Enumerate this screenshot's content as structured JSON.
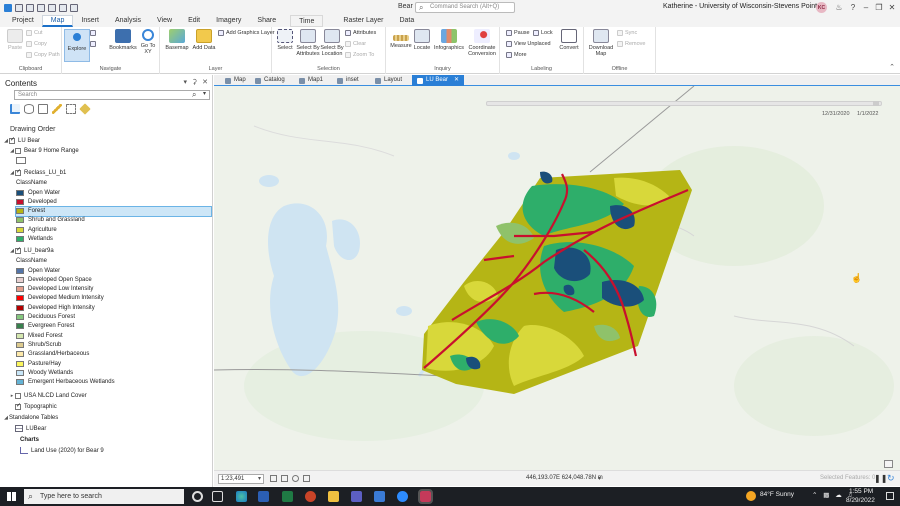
{
  "window": {
    "document_title": "Bear",
    "command_search_placeholder": "Command Search (Alt+Q)",
    "user": "Katherine - University of Wisconsin-Stevens Point",
    "user_initials": "KC"
  },
  "ribbon_tabs": [
    {
      "label": "Project",
      "active": false
    },
    {
      "label": "Map",
      "active": true
    },
    {
      "label": "Insert",
      "active": false
    },
    {
      "label": "Analysis",
      "active": false
    },
    {
      "label": "View",
      "active": false
    },
    {
      "label": "Edit",
      "active": false
    },
    {
      "label": "Imagery",
      "active": false
    },
    {
      "label": "Share",
      "active": false
    },
    {
      "label": "Time",
      "active": false
    },
    {
      "label": "Raster Layer",
      "active": false
    },
    {
      "label": "Data",
      "active": false
    }
  ],
  "ribbon": {
    "clipboard": {
      "label": "Clipboard",
      "paste": "Paste",
      "cut": "Cut",
      "copy": "Copy",
      "copy_path": "Copy Path"
    },
    "navigate": {
      "label": "Navigate",
      "explore": "Explore",
      "bookmarks": "Bookmarks",
      "goto": "Go To XY"
    },
    "layer": {
      "label": "Layer",
      "basemap": "Basemap",
      "add_data": "Add Data",
      "add_graphics": "Add Graphics Layer"
    },
    "selection": {
      "label": "Selection",
      "select": "Select",
      "by_attributes": "Select By Attributes",
      "by_location": "Select By Location",
      "attributes": "Attributes",
      "clear": "Clear",
      "zoom_to": "Zoom To"
    },
    "inquiry": {
      "label": "Inquiry",
      "measure": "Measure",
      "locate": "Locate",
      "infographics": "Infographics",
      "coordinate": "Coordinate Conversion"
    },
    "labeling": {
      "label": "Labeling",
      "pause": "Pause",
      "lock": "Lock",
      "view_unplaced": "View Unplaced",
      "more": "More",
      "convert": "Convert"
    },
    "offline": {
      "label": "Offline",
      "download": "Download Map",
      "sync": "Sync",
      "remove": "Remove"
    }
  },
  "contents": {
    "title": "Contents",
    "search_placeholder": "Search",
    "drawing_order": "Drawing Order",
    "map_name": "LU Bear",
    "layers": [
      {
        "name": "Bear 9 Home Range",
        "checked": false
      },
      {
        "name": "Reclass_LU_b1",
        "checked": true,
        "field": "ClassName",
        "classes": [
          {
            "label": "Open Water",
            "color": "#1a4f7a"
          },
          {
            "label": "Developed",
            "color": "#c8102e"
          },
          {
            "label": "Forest",
            "color": "#b5b515",
            "selected": true
          },
          {
            "label": "Shrub and Grassland",
            "color": "#8fc26a"
          },
          {
            "label": "Agriculture",
            "color": "#d8d83a"
          },
          {
            "label": "Wetlands",
            "color": "#2eae6a"
          }
        ]
      },
      {
        "name": "LU_bear9a",
        "checked": true,
        "field": "ClassName",
        "classes": [
          {
            "label": "Open Water",
            "color": "#5475a8"
          },
          {
            "label": "Developed Open Space",
            "color": "#e8d1d1"
          },
          {
            "label": "Developed Low Intensity",
            "color": "#e29e8c"
          },
          {
            "label": "Developed Medium Intensity",
            "color": "#ff0000"
          },
          {
            "label": "Developed High Intensity",
            "color": "#b50000"
          },
          {
            "label": "Deciduous Forest",
            "color": "#85c77e"
          },
          {
            "label": "Evergreen Forest",
            "color": "#38814e"
          },
          {
            "label": "Mixed Forest",
            "color": "#d4e7b0"
          },
          {
            "label": "Shrub/Scrub",
            "color": "#dcca8f"
          },
          {
            "label": "Grassland/Herbaceous",
            "color": "#fde9aa"
          },
          {
            "label": "Pasture/Hay",
            "color": "#fbf65d"
          },
          {
            "label": "Woody Wetlands",
            "color": "#c8e6f8"
          },
          {
            "label": "Emergent Herbaceous Wetlands",
            "color": "#64b3d5"
          }
        ]
      },
      {
        "name": "USA NLCD Land Cover",
        "checked": false
      },
      {
        "name": "Topographic",
        "checked": true
      }
    ],
    "standalone_tables": "Standalone Tables",
    "table_name": "LUBear",
    "charts_label": "Charts",
    "chart_name": "Land Use (2020) for Bear 9"
  },
  "view_tabs": [
    {
      "label": "Map",
      "active": false
    },
    {
      "label": "Catalog",
      "active": false
    },
    {
      "label": "Map1",
      "active": false
    },
    {
      "label": "inset",
      "active": false
    },
    {
      "label": "Layout",
      "active": false
    },
    {
      "label": "LU Bear",
      "active": true
    }
  ],
  "map": {
    "time_start": "12/31/2020",
    "time_end": "1/1/2022"
  },
  "status": {
    "scale": "1:23,491",
    "coordinates": "446,193.07E 624,048.78N m",
    "selected_features": "Selected Features: 0"
  },
  "taskbar": {
    "search_placeholder": "Type here to search",
    "weather": "84°F  Sunny",
    "time": "1:55 PM",
    "date": "8/29/2022"
  },
  "colors": {
    "accent": "#2a7fd6",
    "water": "#1a4f7a",
    "developed": "#c8102e",
    "forest": "#b5b515",
    "wetlands": "#2eae6a"
  }
}
